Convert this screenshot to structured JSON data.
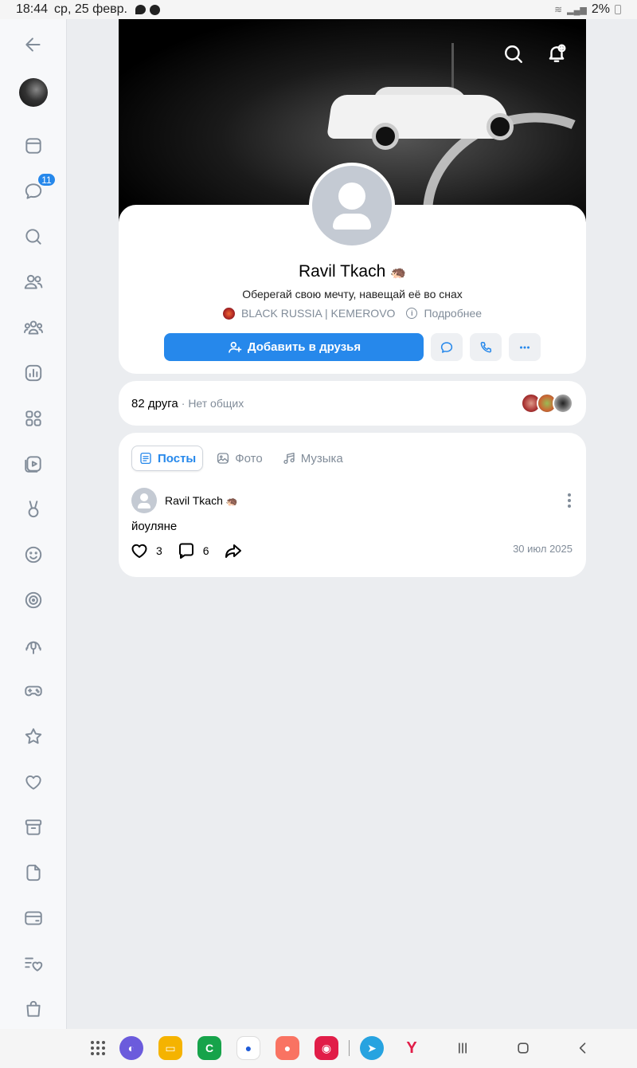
{
  "status_bar": {
    "time": "18:44",
    "date": "ср, 25 февр.",
    "battery": "2%"
  },
  "sidebar": {
    "messages_badge": "11",
    "items": [
      {
        "icon": "back-arrow-icon"
      },
      {
        "icon": "avatar"
      },
      {
        "icon": "news-icon"
      },
      {
        "icon": "messages-icon"
      },
      {
        "icon": "search-icon"
      },
      {
        "icon": "friends-icon"
      },
      {
        "icon": "communities-icon"
      },
      {
        "icon": "stats-icon"
      },
      {
        "icon": "services-icon"
      },
      {
        "icon": "video-icon"
      },
      {
        "icon": "clips-icon"
      },
      {
        "icon": "stickers-icon"
      },
      {
        "icon": "target-icon"
      },
      {
        "icon": "podcasts-icon"
      },
      {
        "icon": "games-icon"
      },
      {
        "icon": "favorites-icon"
      },
      {
        "icon": "likes-icon"
      },
      {
        "icon": "archive-icon"
      },
      {
        "icon": "documents-icon"
      },
      {
        "icon": "payments-icon"
      },
      {
        "icon": "wishlist-icon"
      },
      {
        "icon": "shop-icon"
      }
    ]
  },
  "profile": {
    "name": "Ravil Tkach",
    "name_emoji": "🦔",
    "status": "Оберегай свою мечту, навещай её во снах",
    "group": "BLACK RUSSIA | KEMEROVO",
    "more_link": "Подробнее",
    "add_friend_label": "Добавить в друзья"
  },
  "friends": {
    "count": "82 друга",
    "mutual": "· Нет общих"
  },
  "tabs": [
    {
      "label": "Посты",
      "active": true
    },
    {
      "label": "Фото",
      "active": false
    },
    {
      "label": "Музыка",
      "active": false
    }
  ],
  "post": {
    "author": "Ravil Tkach",
    "author_emoji": "🦔",
    "text": "йоуляне",
    "likes": "3",
    "comments": "6",
    "date": "30 июл 2025"
  },
  "colors": {
    "accent": "#2688eb",
    "background": "#ebedf0",
    "secondary_text": "#818c99"
  }
}
